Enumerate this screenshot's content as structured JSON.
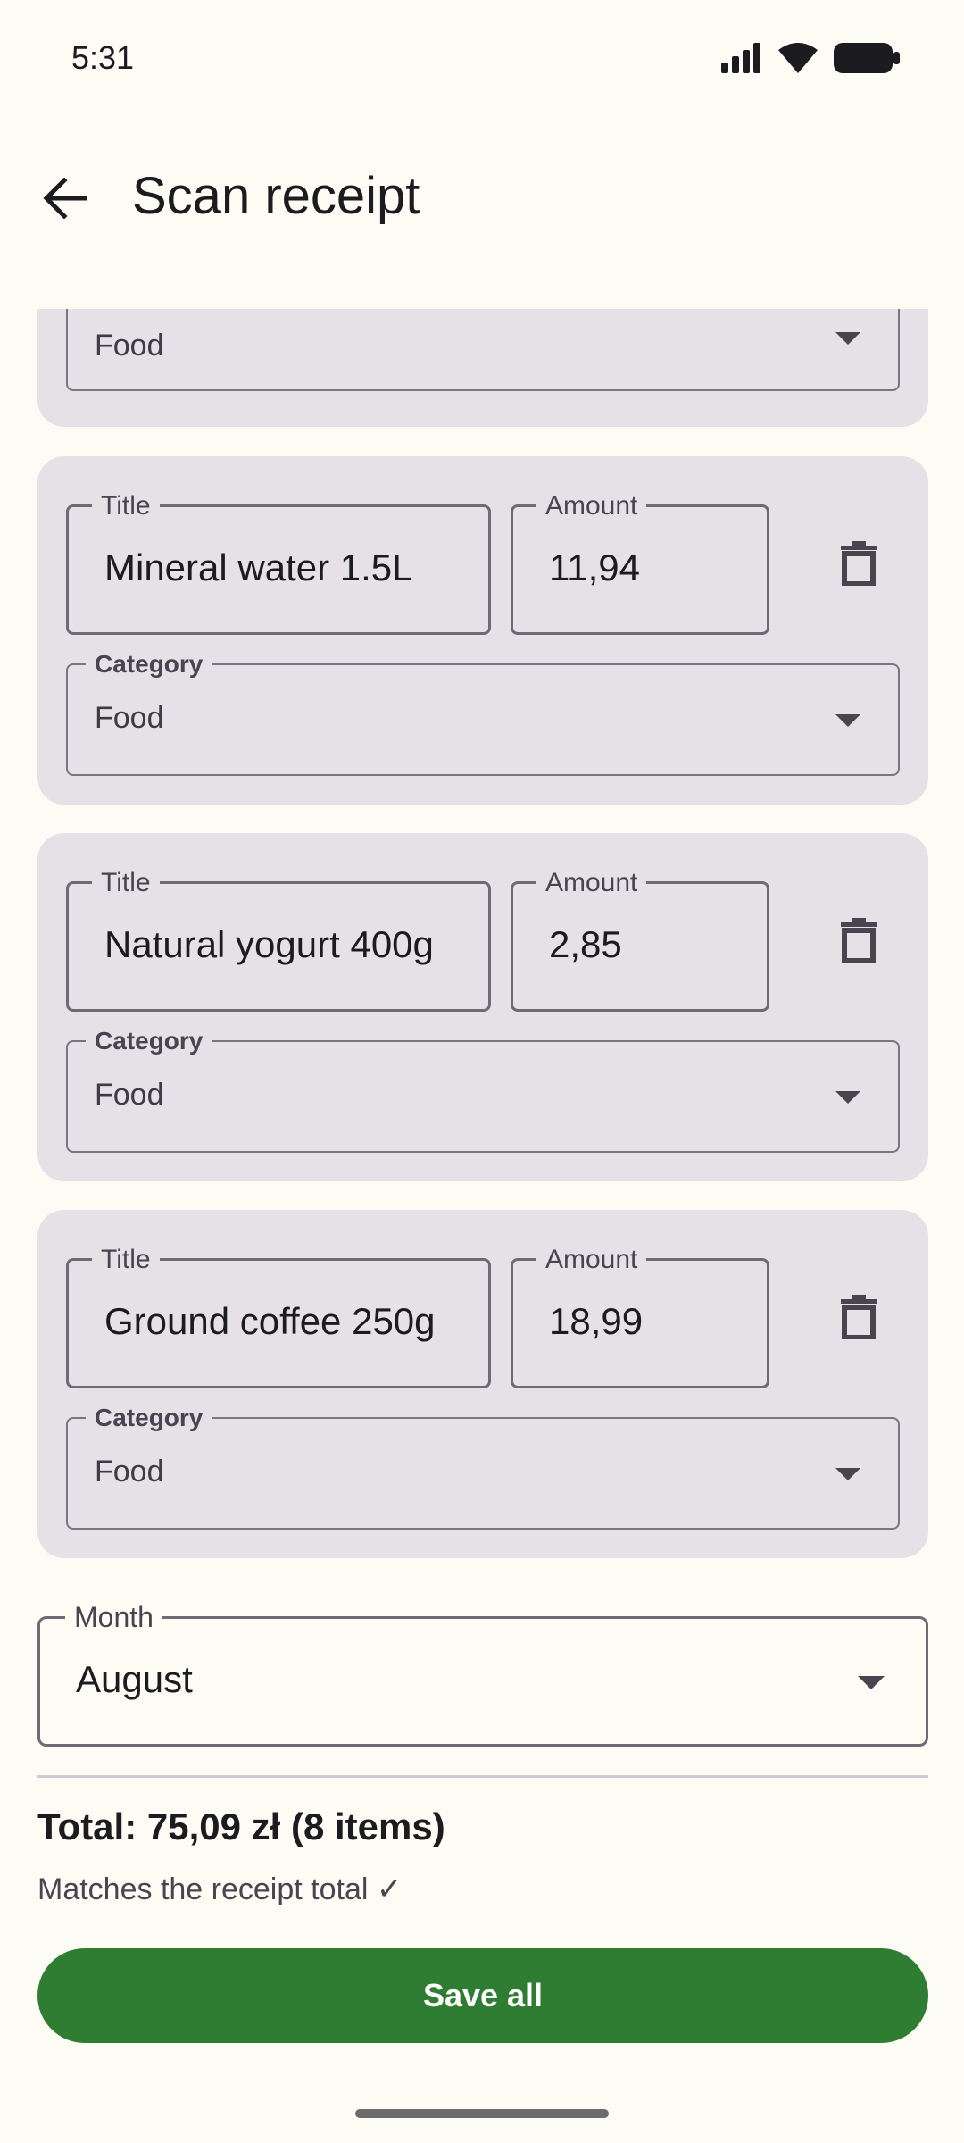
{
  "status_bar": {
    "time": "5:31",
    "icons": [
      "signal-icon",
      "wifi-icon",
      "battery-icon"
    ]
  },
  "app_bar": {
    "back_icon": "arrow-back-icon",
    "title": "Scan receipt"
  },
  "items": [
    {
      "category_label": "",
      "category_value": "Food"
    },
    {
      "title_label": "Title",
      "title_value": "Mineral water 1.5L",
      "amount_label": "Amount",
      "amount_value": "11,94",
      "category_label": "Category",
      "category_value": "Food"
    },
    {
      "title_label": "Title",
      "title_value": "Natural yogurt 400g",
      "amount_label": "Amount",
      "amount_value": "2,85",
      "category_label": "Category",
      "category_value": "Food"
    },
    {
      "title_label": "Title",
      "title_value": "Ground coffee 250g",
      "amount_label": "Amount",
      "amount_value": "18,99",
      "category_label": "Category",
      "category_value": "Food"
    }
  ],
  "month": {
    "label": "Month",
    "value": "August"
  },
  "summary": {
    "total": "Total: 75,09 zł (8 items)",
    "match": "Matches the receipt total ✓"
  },
  "actions": {
    "save_label": "Save all"
  },
  "colors": {
    "background": "#fcfcf5",
    "card": "#e6e0e7",
    "primary": "#2e7d32",
    "outline": "#7a757f"
  }
}
